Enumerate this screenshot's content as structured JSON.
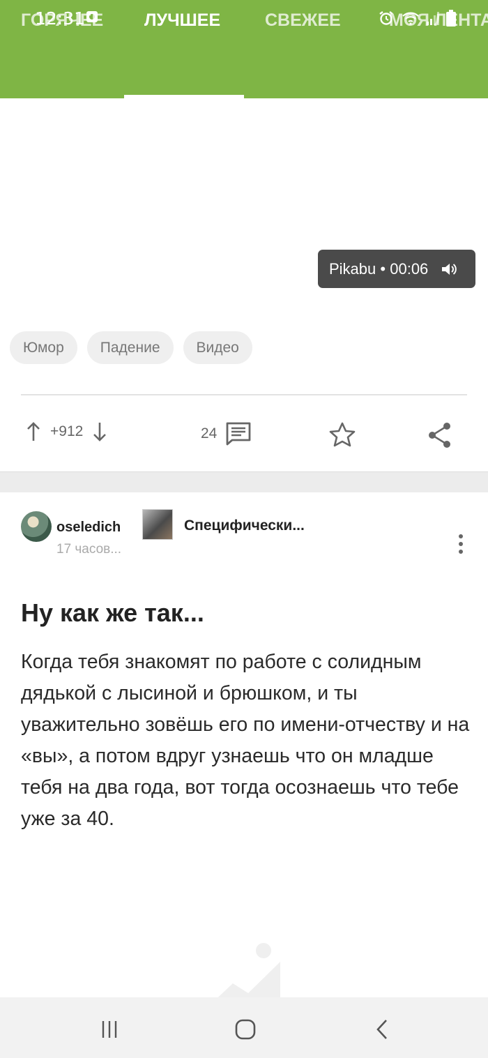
{
  "status_bar": {
    "time": "12:31"
  },
  "tabs": [
    {
      "label": "ГОРЯЧЕЕ",
      "active": false
    },
    {
      "label": "ЛУЧШЕЕ",
      "active": true
    },
    {
      "label": "СВЕЖЕЕ",
      "active": false
    },
    {
      "label": "МОЯ ЛЕНТА",
      "active": false
    }
  ],
  "post1": {
    "video": {
      "source": "Pikabu",
      "separator": "•",
      "duration": "00:06"
    },
    "tags": [
      "Юмор",
      "Падение",
      "Видео"
    ],
    "rating": "+912",
    "comments": "24"
  },
  "post2": {
    "author": "oseledich",
    "time": "17 часов...",
    "community": "Специфически...",
    "title": "Ну как же так...",
    "body": "Когда тебя знакомят по работе с солидным дядькой с лысиной и брюшком, и ты уважительно зовёшь его по имени-отчеству и на «вы», а потом вдруг узнаешь что он младше тебя на два года, вот тогда осознаешь что тебе уже за 40."
  },
  "colors": {
    "brand_green": "#7fb545",
    "icon_gray": "#666666"
  }
}
